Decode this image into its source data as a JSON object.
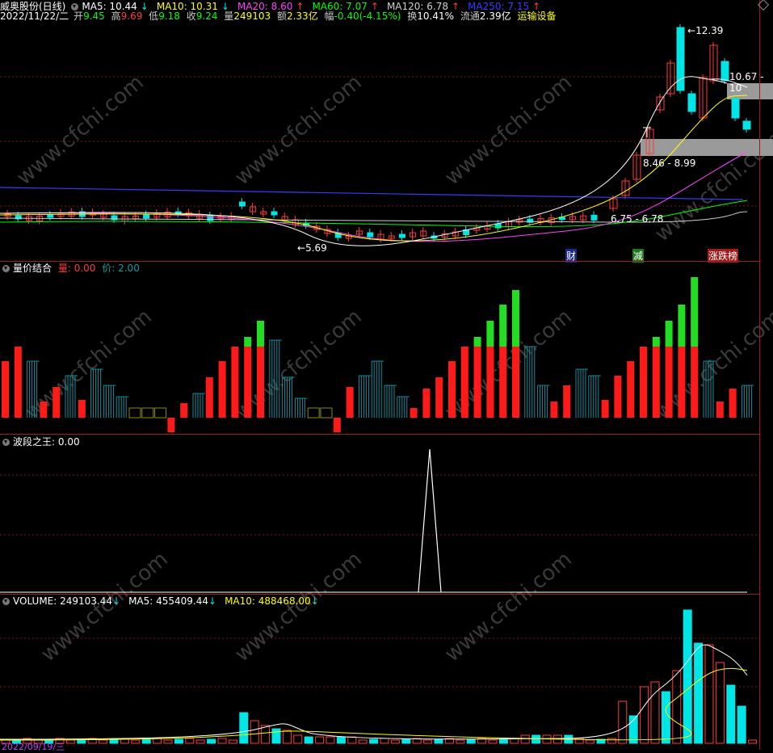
{
  "colors": {
    "up": "#ff3b3b",
    "down": "#00e5e5",
    "ma5": "#ffffff",
    "ma10": "#ffff00",
    "ma20": "#ff44ff",
    "ma60": "#00ff00",
    "ma120": "#cfcfcf",
    "ma250": "#3a3aff",
    "bg": "#000000",
    "grid": "#7a1a1a"
  },
  "main": {
    "stock": "威奥股份(日线)",
    "ma5": "MA5: 10.44",
    "ma10": "MA10: 10.31",
    "ma20": "MA20: 8.60",
    "ma60": "MA60: 7.07",
    "ma120": "MA120: 6.78",
    "ma250": "MA250: 7.15",
    "date": "2022/11/22/二",
    "open_l": "开",
    "open_v": "9.45",
    "high_l": "高",
    "high_v": "9.69",
    "low_l": "低",
    "low_v": "9.18",
    "close_l": "收",
    "close_v": "9.24",
    "vol_l": "量",
    "vol_v": "249103",
    "amt_l": "额",
    "amt_v": "2.33亿",
    "chg_l": "幅",
    "chg_v": "-0.40(-4.15%)",
    "turn_l": "换",
    "turn_v": "10.41%",
    "float_l": "流通",
    "float_v": "2.39亿",
    "sector": "运输设备",
    "high_mark": "12.39",
    "low_mark": "5.69",
    "zone1": "10.67 - 10",
    "zone2": "8.46 - 8.99",
    "zone3": "6.75 - 6.78",
    "tag_cai": "财",
    "tag_jian": "减",
    "tag_zd": "涨跌榜"
  },
  "panel2": {
    "title": "量价结合",
    "l1": "量: 0.00",
    "l2": "价: 2.00"
  },
  "panel3": {
    "title": "波段之王",
    "value": ": 0.00"
  },
  "panel4": {
    "title": "VOLUME: 249103.44",
    "ma5": "MA5: 455409.44",
    "ma10": "MA10: 488468.00",
    "date": "2022/09/19/三"
  },
  "icons": {
    "collapse": "collapse-icon",
    "arrow_down": "arrow-down-icon",
    "arrow_up": "arrow-up-icon",
    "settings": "diamond-icon"
  },
  "watermark": "www.cfchi.com"
}
